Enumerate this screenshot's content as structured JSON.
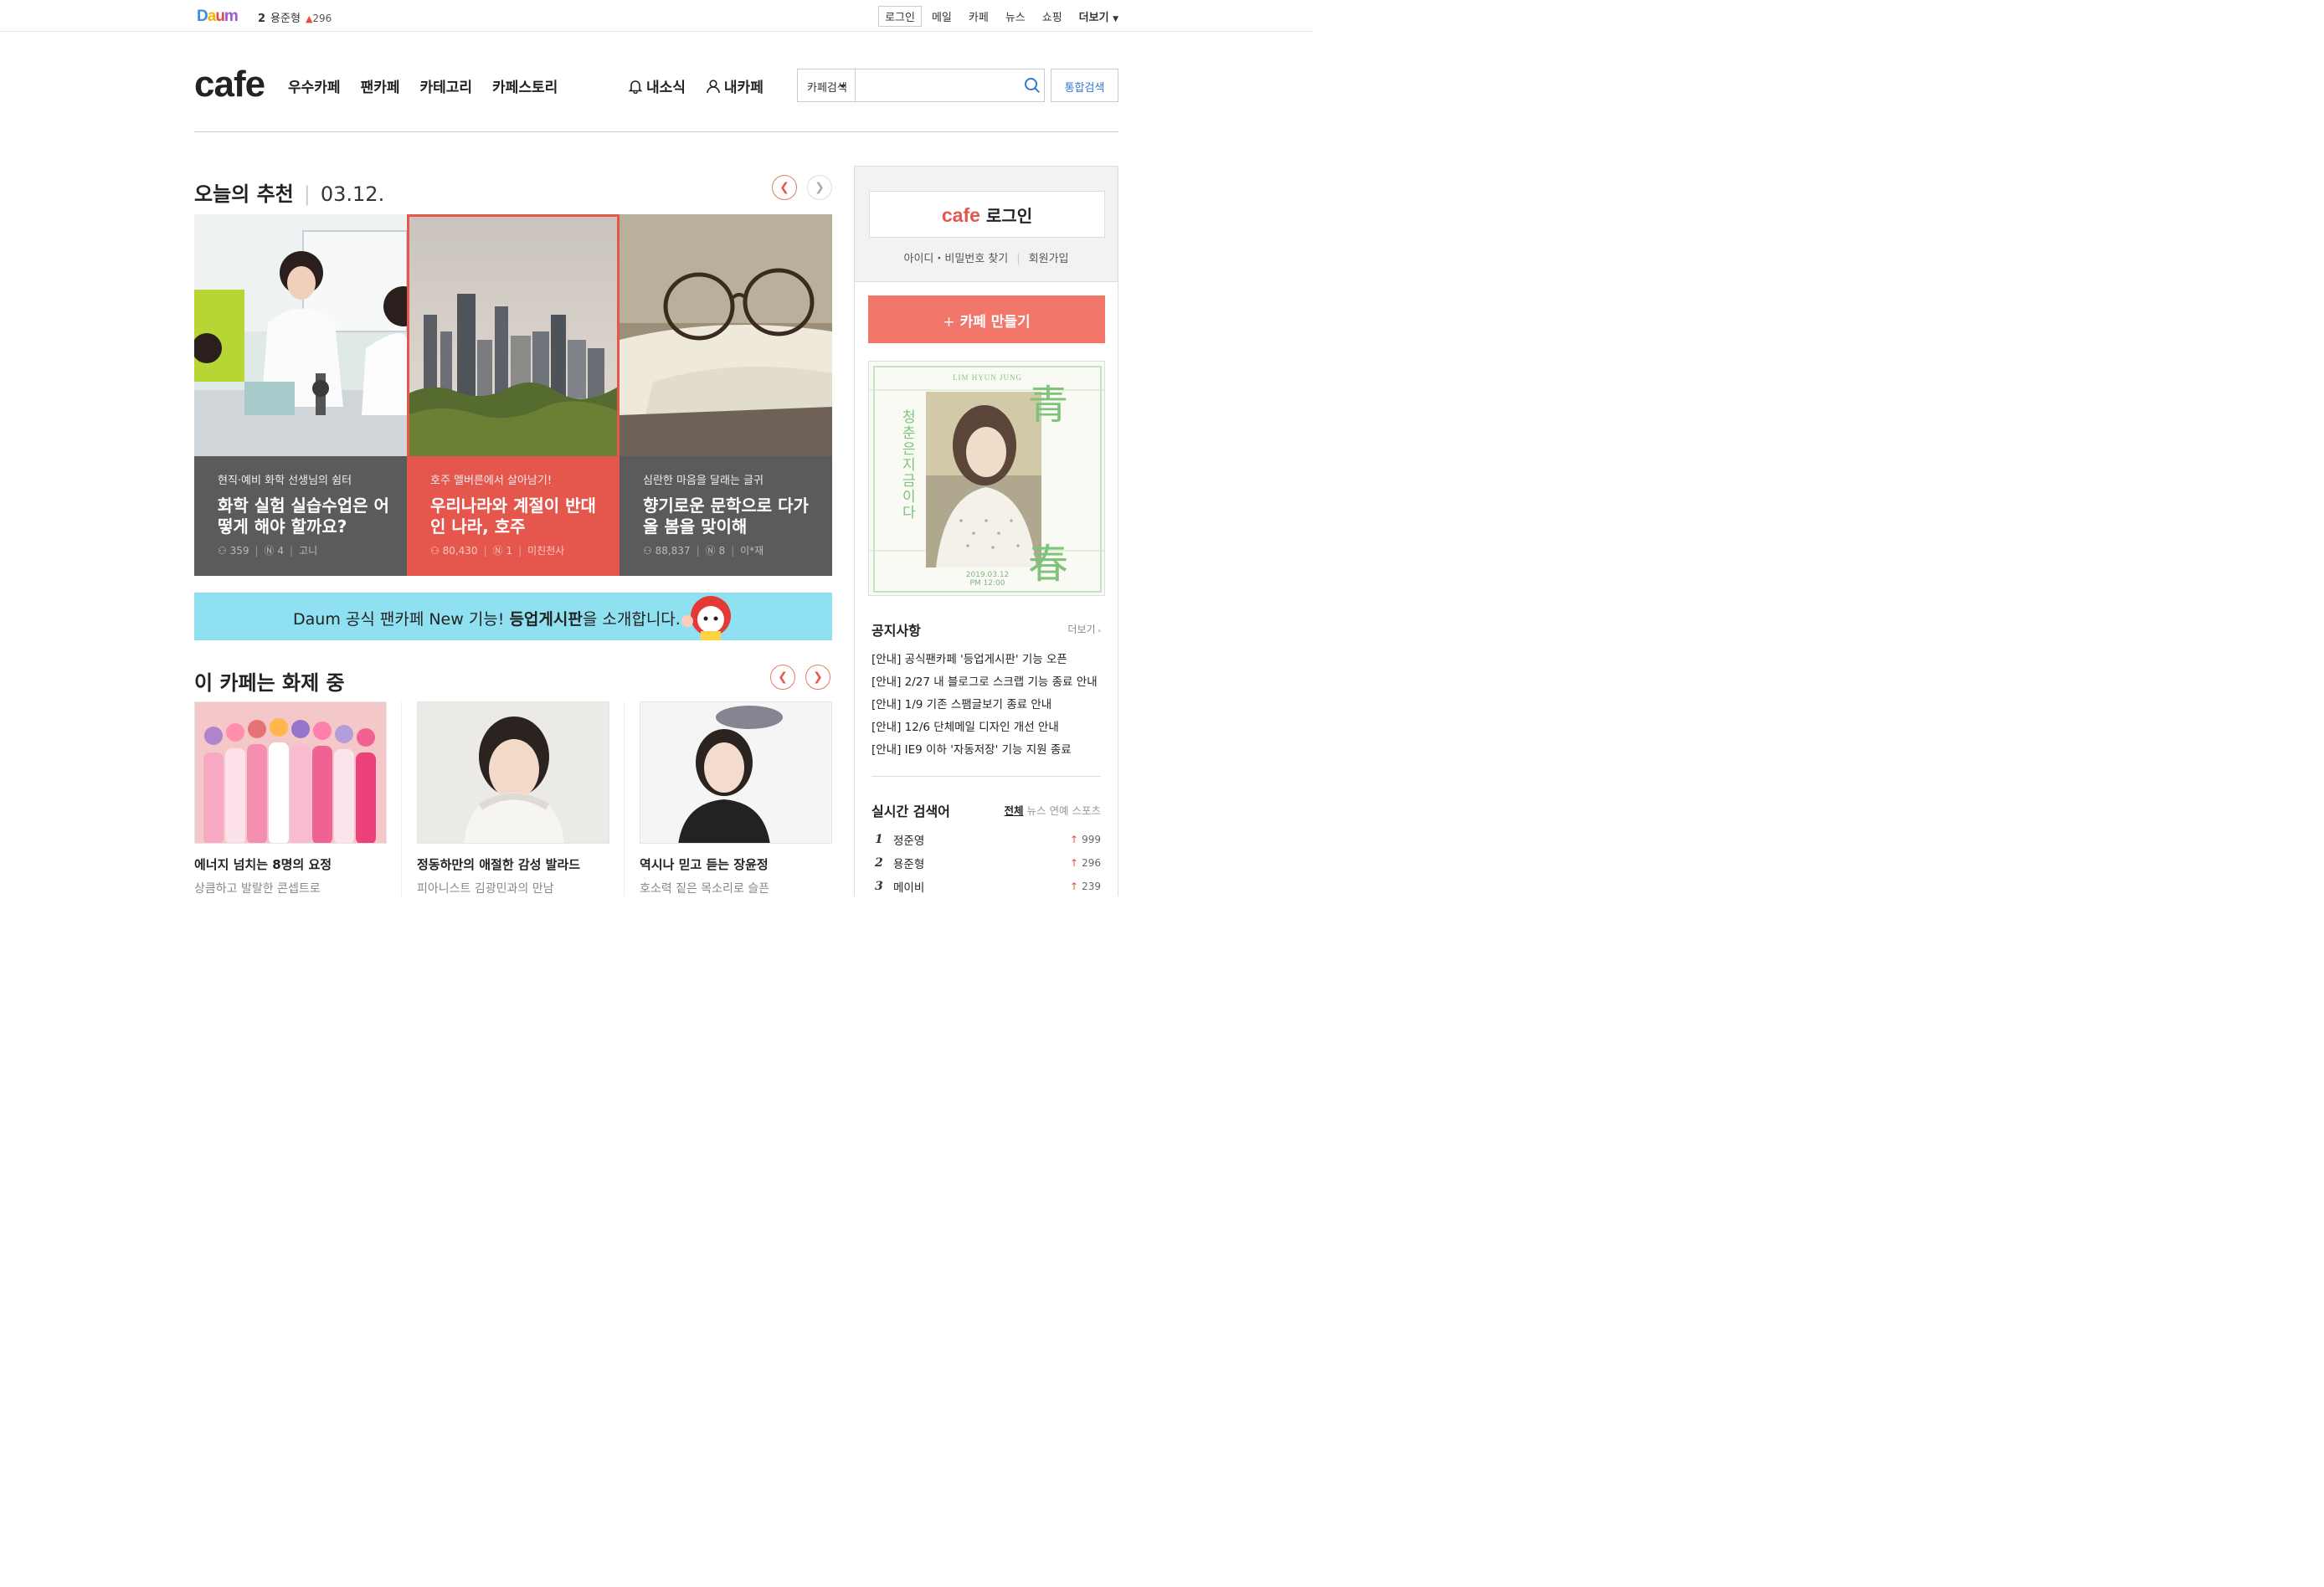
{
  "topbar": {
    "logo_letters": [
      "D",
      "a",
      "u",
      "m"
    ],
    "rank_no": "2",
    "rank_keyword": "용준형",
    "rank_change": "296",
    "login_label": "로그인",
    "links": [
      "메일",
      "카페",
      "뉴스",
      "쇼핑"
    ],
    "more_label": "더보기"
  },
  "header": {
    "logo": "cafe",
    "nav": [
      "우수카페",
      "팬카페",
      "카테고리",
      "카페스토리"
    ],
    "my_news": "내소식",
    "my_cafe": "내카페",
    "search_select": "카페검색",
    "search_value": "",
    "unified_search": "통합검색"
  },
  "today": {
    "title": "오늘의 추천",
    "date": "03.12.",
    "cards": [
      {
        "sub": "현직·예비 화학 선생님의 쉼터",
        "title": "화학 실험 실습수업은 어떻게 해야 할까요?",
        "members": "359",
        "posts": "4",
        "author": "고니"
      },
      {
        "sub": "호주 멜버른에서 살아남기!",
        "title": "우리나라와 계절이 반대인 나라, 호주",
        "members": "80,430",
        "posts": "1",
        "author": "미친천사"
      },
      {
        "sub": "심란한 마음을 달래는 글귀",
        "title": "향기로운 문학으로 다가올 봄을 맞이해",
        "members": "88,837",
        "posts": "8",
        "author": "이*재"
      }
    ]
  },
  "banner": {
    "pre": "Daum 공식 팬카페 New 기능! ",
    "bold": "등업게시판",
    "post": "을 소개합니다."
  },
  "hot": {
    "title": "이 카페는 화제 중",
    "items": [
      {
        "title": "에너지 넘치는 8명의 요정",
        "sub": "상큼하고 발랄한 콘셉트로"
      },
      {
        "title": "정동하만의 애절한 감성 발라드",
        "sub": "피아니스트 김광민과의 만남"
      },
      {
        "title": "역시나 믿고 듣는 장윤정",
        "sub": "호소력 짙은 목소리로 슬픈"
      }
    ]
  },
  "side": {
    "login_logo": "cafe",
    "login_label": "로그인",
    "find_label": "아이디・비밀번호 찾기",
    "join_label": "회원가입",
    "make_label": "카페 만들기",
    "poster": {
      "name": "LIM HYUN JUNG",
      "vertical": "청춘은 지금이다",
      "char1": "青",
      "char2": "春",
      "date": "2019.03.12",
      "time": "PM 12:00"
    },
    "notice_title": "공지사항",
    "notice_more": "더보기",
    "notices": [
      "[안내] 공식팬카페 '등업게시판' 기능 오픈",
      "[안내] 2/27 내 블로그로 스크랩 기능 종료 안내",
      "[안내] 1/9 기존 스팸글보기 종료 안내",
      "[안내] 12/6 단체메일 디자인 개선 안내",
      "[안내] IE9 이하 '자동저장' 기능 지원 종료"
    ],
    "realtime_title": "실시간 검색어",
    "realtime_tabs": [
      "전체",
      "뉴스",
      "연예",
      "스포츠"
    ],
    "realtime": [
      {
        "rank": "1",
        "keyword": "정준영",
        "count": "999"
      },
      {
        "rank": "2",
        "keyword": "용준형",
        "count": "296"
      },
      {
        "rank": "3",
        "keyword": "메이비",
        "count": "239"
      }
    ]
  },
  "colors": {
    "accent": "#e5574d",
    "link_blue": "#3477d4",
    "banner_bg": "#8fe0f0",
    "make_btn": "#f2766a"
  }
}
